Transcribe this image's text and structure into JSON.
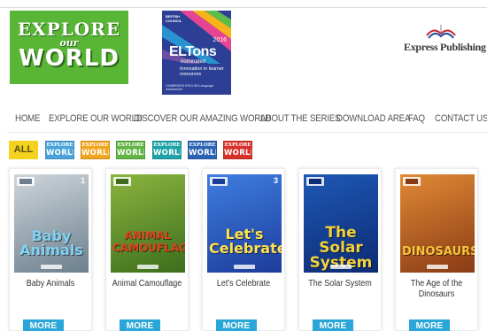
{
  "header": {
    "logo": {
      "line1": "EXPLORE",
      "line2": "our",
      "line3": "WORLD"
    },
    "award": {
      "org": "BRITISH COUNCIL",
      "year": "2016",
      "name": "ELTons",
      "status": "nominated",
      "category": "Innovation in learner resources",
      "sponsor": "CAMBRIDGE ENGLISH Language Assessment"
    },
    "publisher": "Express Publishing"
  },
  "nav": {
    "items": [
      {
        "label": "HOME"
      },
      {
        "label": "EXPLORE OUR WORLD"
      },
      {
        "label": "DISCOVER OUR AMAZING WORLD"
      },
      {
        "label": "ABOUT THE SERIES"
      },
      {
        "label": "DOWNLOAD AREA"
      },
      {
        "label": "FAQ"
      },
      {
        "label": "CONTACT US"
      }
    ]
  },
  "filters": {
    "all_label": "ALL",
    "series": [
      {
        "line1": "EXPLORE",
        "line2": "WORLD",
        "color": "#4aa3d9"
      },
      {
        "line1": "EXPLORE",
        "line2": "WORLD",
        "color": "#f2a51f"
      },
      {
        "line1": "EXPLORE",
        "line2": "WORLD",
        "color": "#62b544"
      },
      {
        "line1": "EXPLORE",
        "line2": "WORLD",
        "color": "#1fa3a8"
      },
      {
        "line1": "EXPLORE",
        "line2": "WORLD",
        "color": "#2c64b5"
      },
      {
        "line1": "EXPLORE",
        "line2": "WORLD",
        "color": "#d8312b"
      }
    ]
  },
  "books": [
    {
      "title": "Baby Animals",
      "cover_title": "Baby Animals",
      "level": "1",
      "more": "MORE",
      "cover_colors": [
        "#6b7f8e",
        "#cfd6da"
      ],
      "title_color": "#7fd2f3"
    },
    {
      "title": "Animal Camouflage",
      "cover_title": "ANIMAL CAMOUFLAGE",
      "level": "",
      "more": "MORE",
      "cover_colors": [
        "#3d6d1d",
        "#8bb53f"
      ],
      "title_color": "#e0421f"
    },
    {
      "title": "Let's Celebrate",
      "cover_title": "Let's Celebrate!",
      "level": "3",
      "more": "MORE",
      "cover_colors": [
        "#1c3c9b",
        "#3f7ee0"
      ],
      "title_color": "#ffe14a"
    },
    {
      "title": "The Solar System",
      "cover_title": "The Solar System",
      "level": "",
      "more": "MORE",
      "cover_colors": [
        "#0c2b73",
        "#1f58b5"
      ],
      "title_color": "#f5d23a"
    },
    {
      "title": "The Age of the Dinosaurs",
      "cover_title": "DINOSAURS",
      "level": "",
      "more": "MORE",
      "cover_colors": [
        "#8a3a15",
        "#e08a35"
      ],
      "title_color": "#f7c43a"
    }
  ]
}
